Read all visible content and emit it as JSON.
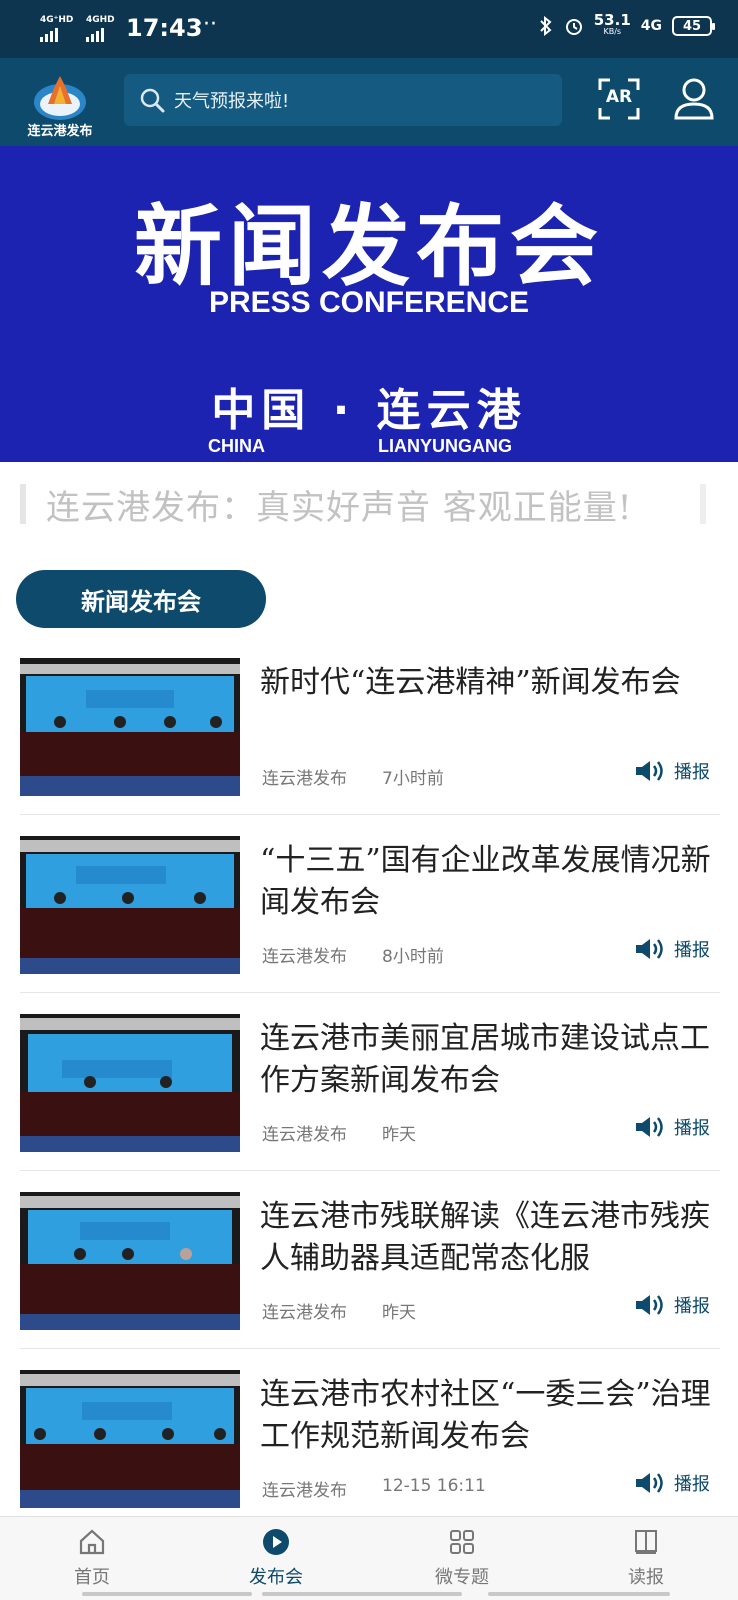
{
  "status_bar": {
    "signal1": "4G⁺HD",
    "signal2": "4GHD",
    "time": "17:43",
    "more": "···",
    "speed_value": "53.1",
    "speed_unit": "KB/s",
    "network": "4G",
    "battery": "45"
  },
  "header": {
    "logo_text": "连云港发布",
    "search_placeholder": "天气预报来啦!",
    "ar_label": "AR"
  },
  "banner": {
    "title": "新闻发布会",
    "subtitle": "PRESS CONFERENCE",
    "location": "中国 · 连云港",
    "china": "CHINA",
    "lianyungang": "LIANYUNGANG"
  },
  "slogan": "连云港发布：真实好声音 客观正能量!",
  "section_title": "新闻发布会",
  "news": [
    {
      "title": "新时代“连云港精神”新闻发布会",
      "source": "连云港发布",
      "time": "7小时前",
      "play": "播报"
    },
    {
      "title": "“十三五”国有企业改革发展情况新闻发布会",
      "source": "连云港发布",
      "time": "8小时前",
      "play": "播报"
    },
    {
      "title": "连云港市美丽宜居城市建设试点工作方案新闻发布会",
      "source": "连云港发布",
      "time": "昨天",
      "play": "播报"
    },
    {
      "title": "连云港市残联解读《连云港市残疾人辅助器具适配常态化服",
      "source": "连云港发布",
      "time": "昨天",
      "play": "播报"
    },
    {
      "title": "连云港市农村社区“一委三会”治理工作规范新闻发布会",
      "source": "连云港发布",
      "time": "12-15 16:11",
      "play": "播报"
    }
  ],
  "nav": [
    {
      "label": "首页",
      "icon": "home-icon"
    },
    {
      "label": "发布会",
      "icon": "play-circle-icon"
    },
    {
      "label": "微专题",
      "icon": "grid-icon"
    },
    {
      "label": "读报",
      "icon": "book-icon"
    }
  ],
  "colors": {
    "primary": "#0d4a6c",
    "banner": "#1c23b0",
    "status_bar": "#0d3550"
  }
}
